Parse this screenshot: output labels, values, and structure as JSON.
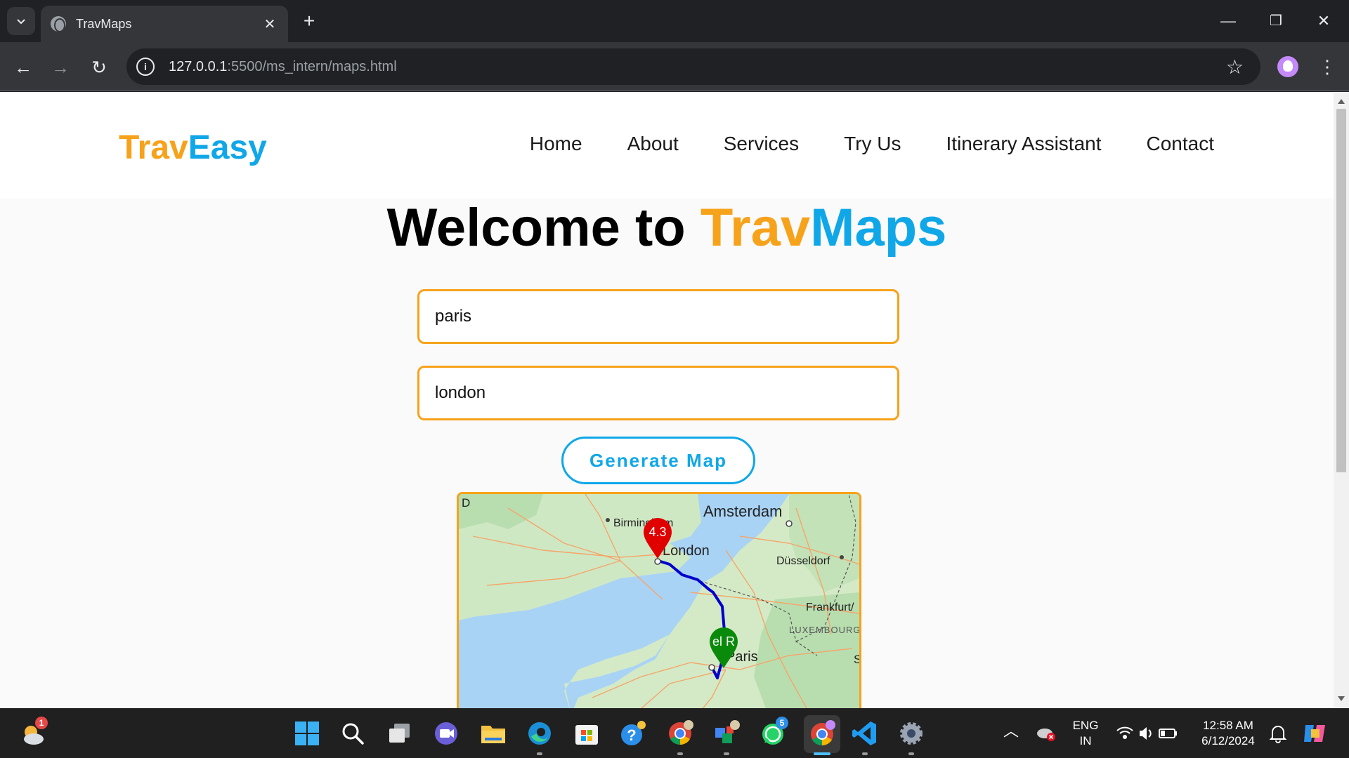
{
  "browser": {
    "tab_title": "TravMaps",
    "url_host": "127.0.0.1",
    "url_path": ":5500/ms_intern/maps.html"
  },
  "site": {
    "logo_part1": "Trav",
    "logo_part2": "Easy",
    "nav": [
      "Home",
      "About",
      "Services",
      "Try Us",
      "Itinerary Assistant",
      "Contact"
    ],
    "hero_prefix": "Welcome to ",
    "hero_part1": "Trav",
    "hero_part2": "Maps",
    "origin_value": "paris",
    "destination_value": "london",
    "generate_button": "Generate Map"
  },
  "map": {
    "labels": {
      "amsterdam": "Amsterdam",
      "birmingham": "Birmingham",
      "london": "London",
      "dusseldorf": "Düsseldorf",
      "frankfurt": "Frankfurt/",
      "luxembourg": "LUXEMBOURG",
      "paris": "Paris",
      "edge_d": "D",
      "edge_s": "S"
    },
    "marker_red_label": "4.3",
    "marker_green_label": "el R",
    "colors": {
      "route": "#0000cc",
      "marker_red": "#e00000",
      "marker_green": "#0a8a0a"
    }
  },
  "taskbar": {
    "weather_badge": "1",
    "whatsapp_badge": "5",
    "lang_line1": "ENG",
    "lang_line2": "IN",
    "time": "12:58 AM",
    "date": "6/12/2024"
  },
  "theme": {
    "orange": "#f7a21b",
    "blue": "#10a7e8"
  }
}
